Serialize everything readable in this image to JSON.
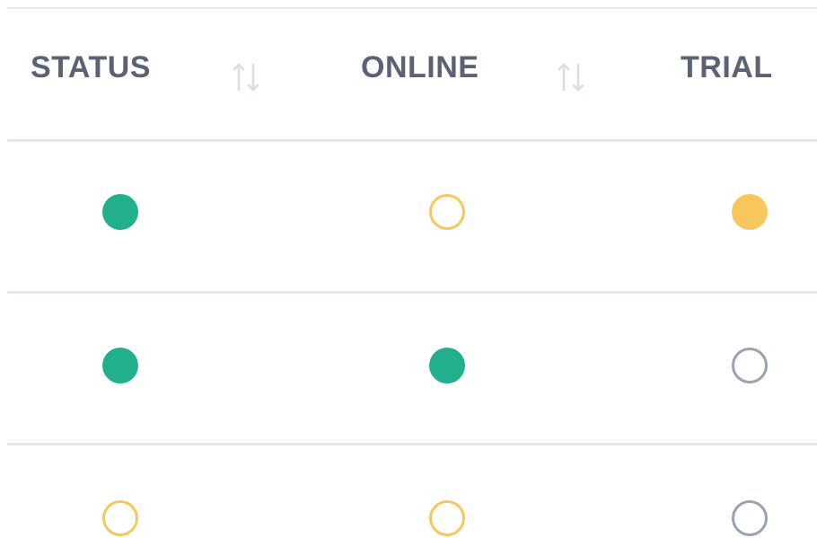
{
  "table": {
    "columns": [
      {
        "label": "STATUS",
        "sortable": true
      },
      {
        "label": "ONLINE",
        "sortable": true
      },
      {
        "label": "TRIAL",
        "sortable": false
      }
    ],
    "rows": [
      {
        "status": "filled-green",
        "online": "ring-yellow",
        "trial": "filled-yellow"
      },
      {
        "status": "filled-green",
        "online": "filled-green",
        "trial": "ring-gray"
      },
      {
        "status": "ring-yellow",
        "online": "ring-yellow",
        "trial": "ring-gray"
      }
    ]
  },
  "icons": {
    "sort": "sort-arrows-icon",
    "indicator": "status-dot-icon"
  },
  "colors": {
    "green": "#22b08c",
    "yellow": "#f7c75e",
    "gray": "#9aa2b1",
    "header_text": "#5a6274",
    "rule": "#e4e7ee"
  }
}
